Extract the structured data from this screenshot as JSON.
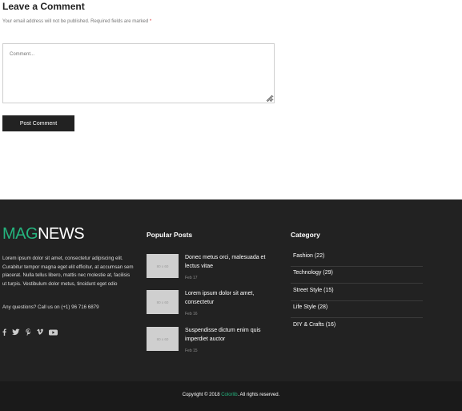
{
  "comment": {
    "title": "Leave a Comment",
    "note": "Your email address will not be published. Required fields are marked",
    "required_mark": "*",
    "placeholder": "Comment...",
    "submit_label": "Post Comment"
  },
  "footer": {
    "logo": {
      "part1": "MAG",
      "part2": "NEWS"
    },
    "about": "Lorem ipsum dolor sit amet, consectetur adipiscing elit. Curabitur tempor magna eget elit efficitur, at accumsan sem placerat. Nulla tellus libero, mattis nec molestie at, facilisis ut turpis. Vestibulum dolor metus, tincidunt eget odio",
    "contact": "Any questions? Call us on (+1) 96 716 6879",
    "socials": [
      "facebook-icon",
      "twitter-icon",
      "pinterest-icon",
      "vimeo-icon",
      "youtube-icon"
    ],
    "popular_title": "Popular Posts",
    "posts": [
      {
        "title": "Donec metus orci, malesuada et lectus vitae",
        "date": "Feb 17",
        "thumb": "80 x 60"
      },
      {
        "title": "Lorem ipsum dolor sit amet, consectetur",
        "date": "Feb 16",
        "thumb": "80 x 60"
      },
      {
        "title": "Suspendisse dictum enim quis imperdiet auctor",
        "date": "Feb 15",
        "thumb": "80 x 60"
      }
    ],
    "category_title": "Category",
    "categories": [
      "Fashion (22)",
      "Technology (29)",
      "Street Style (15)",
      "Life Style (28)",
      "DIY & Crafts (16)"
    ],
    "copyright": {
      "before": "Copyright © 2018",
      "brand": "Colorlib",
      "after": ". All rights reserved."
    }
  },
  "colors": {
    "accent": "#24b47e",
    "footer_bg": "#222222",
    "bottom_bg": "#1a1a1a"
  }
}
